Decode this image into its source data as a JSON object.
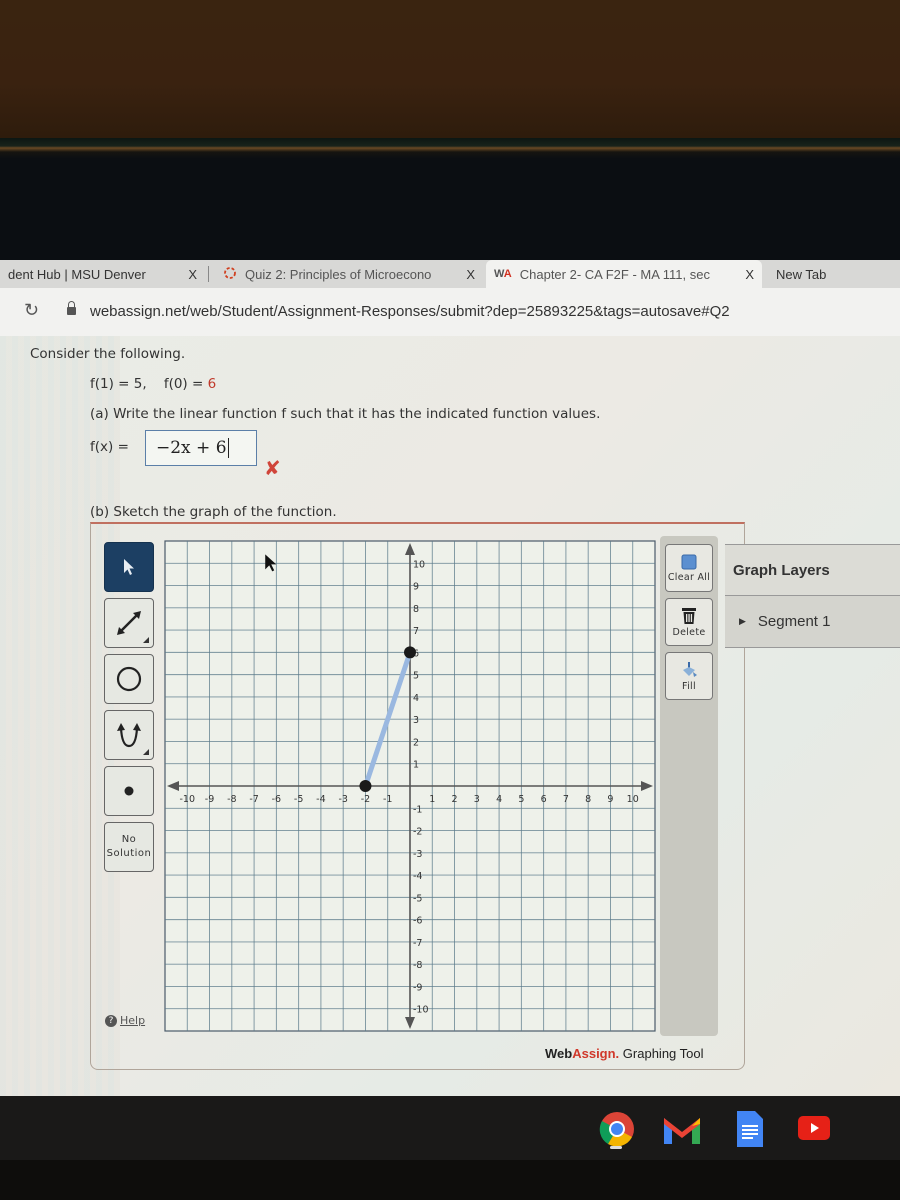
{
  "browser": {
    "tabs": [
      {
        "label": "dent Hub | MSU Denver",
        "icon": "none",
        "close": "X"
      },
      {
        "label": "Quiz 2: Principles of Microecono",
        "icon": "loading-ring-icon",
        "close": "X"
      },
      {
        "label": "Chapter 2- CA F2F - MA 111, sec",
        "icon": "webassign-icon",
        "close": "X",
        "active": true
      },
      {
        "label": "New Tab"
      }
    ],
    "reload_icon": "reload-icon",
    "url": "webassign.net/web/Student/Assignment-Responses/submit?dep=25893225&tags=autosave#Q2"
  },
  "question": {
    "intro": "Consider the following.",
    "given": {
      "f1": "f(1) = 5,",
      "f0_prefix": "f(0) = ",
      "f0_value": "6"
    },
    "part_a": "(a) Write the linear function f such that it has the indicated function values.",
    "fx_label": "f(x) =",
    "answer_value": "−2x + 6",
    "answer_status": "incorrect",
    "wrong_mark": "✘",
    "part_b": "(b) Sketch the graph of the function."
  },
  "graph_tool": {
    "tools": [
      {
        "name": "pointer",
        "icon": "pointer-arrow-icon",
        "active": true
      },
      {
        "name": "line",
        "icon": "line-tool-icon"
      },
      {
        "name": "circle",
        "icon": "circle-tool-icon"
      },
      {
        "name": "parabola",
        "icon": "parabola-tool-icon"
      },
      {
        "name": "point",
        "icon": "point-tool-icon"
      },
      {
        "name": "no-solution",
        "label_line1": "No",
        "label_line2": "Solution"
      }
    ],
    "help_label": "Help",
    "actions": [
      {
        "label": "Clear All",
        "icon": "clear-all-icon"
      },
      {
        "label": "Delete",
        "icon": "trash-icon"
      },
      {
        "label": "Fill",
        "icon": "fill-bucket-icon"
      }
    ],
    "layers_title": "Graph Layers",
    "layers": [
      {
        "label": "Segment 1",
        "icon": "expand-triangle-icon"
      }
    ],
    "brand_web": "Web",
    "brand_assign": "Assign.",
    "brand_suffix": " Graphing Tool"
  },
  "chart_data": {
    "type": "line",
    "xlim": [
      -11,
      11
    ],
    "ylim": [
      -11,
      11
    ],
    "x_ticks": [
      -10,
      -9,
      -8,
      -7,
      -6,
      -5,
      -4,
      -3,
      -2,
      -1,
      1,
      2,
      3,
      4,
      5,
      6,
      7,
      8,
      9,
      10
    ],
    "y_ticks": [
      10,
      9,
      8,
      7,
      6,
      5,
      4,
      3,
      2,
      1,
      -1,
      -2,
      -3,
      -4,
      -5,
      -6,
      -7,
      -8,
      -9,
      -10
    ],
    "grid": true,
    "series": [
      {
        "name": "Segment 1",
        "kind": "segment",
        "points": [
          [
            -2,
            0
          ],
          [
            0,
            6
          ]
        ],
        "color": "#9ab8e0"
      }
    ],
    "cursor": {
      "x": -6.5,
      "y": 10.4
    }
  },
  "shelf": {
    "apps": [
      "chrome-icon",
      "gmail-icon",
      "docs-icon",
      "youtube-icon"
    ]
  }
}
